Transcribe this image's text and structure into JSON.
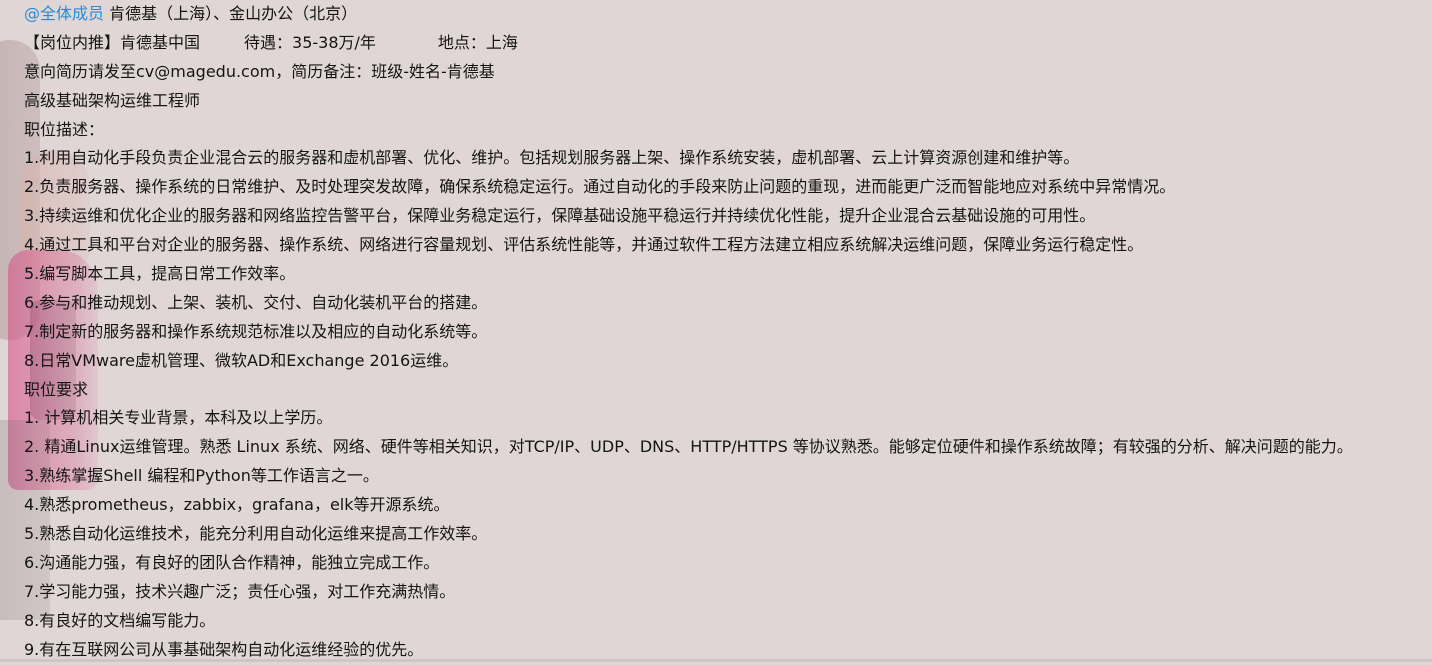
{
  "message": {
    "mention": "@全体成员",
    "header_text": "肯德基（上海）、金山办公（北京）",
    "post_title": "【岗位内推】肯德基中国",
    "salary": "待遇：35-38万/年",
    "location": "地点：上海",
    "email_line": "意向简历请发至cv@magedu.com，简历备注：班级-姓名-肯德基",
    "job_title": "高级基础架构运维工程师",
    "description_heading": "职位描述：",
    "description_items": [
      "1.利用自动化手段负责企业混合云的服务器和虚机部署、优化、维护。包括规划服务器上架、操作系统安装，虚机部署、云上计算资源创建和维护等。",
      "2.负责服务器、操作系统的日常维护、及时处理突发故障，确保系统稳定运行。通过自动化的手段来防止问题的重现，进而能更广泛而智能地应对系统中异常情况。",
      "3.持续运维和优化企业的服务器和网络监控告警平台，保障业务稳定运行，保障基础设施平稳运行并持续优化性能，提升企业混合云基础设施的可用性。",
      "4.通过工具和平台对企业的服务器、操作系统、网络进行容量规划、评估系统性能等，并通过软件工程方法建立相应系统解决运维问题，保障业务运行稳定性。",
      "5.编写脚本工具，提高日常工作效率。",
      "6.参与和推动规划、上架、装机、交付、自动化装机平台的搭建。",
      "7.制定新的服务器和操作系统规范标准以及相应的自动化系统等。",
      "8.日常VMware虚机管理、微软AD和Exchange 2016运维。"
    ],
    "requirements_heading": "职位要求",
    "requirement_items": [
      "1. 计算机相关专业背景，本科及以上学历。",
      "2. 精通Linux运维管理。熟悉 Linux 系统、网络、硬件等相关知识，对TCP/IP、UDP、DNS、HTTP/HTTPS 等协议熟悉。能够定位硬件和操作系统故障；有较强的分析、解决问题的能力。",
      "3.熟练掌握Shell 编程和Python等工作语言之一。",
      "4.熟悉prometheus，zabbix，grafana，elk等开源系统。",
      "5.熟悉自动化运维技术，能充分利用自动化运维来提高工作效率。",
      "6.沟通能力强，有良好的团队合作精神，能独立完成工作。",
      "7.学习能力强，技术兴趣广泛；责任心强，对工作充满热情。",
      "8.有良好的文档编写能力。",
      "9.有在互联网公司从事基础架构自动化运维经验的优先。"
    ]
  },
  "colors": {
    "background": "#e0d6d6",
    "mention": "#2a8ad4",
    "text": "#151515"
  }
}
